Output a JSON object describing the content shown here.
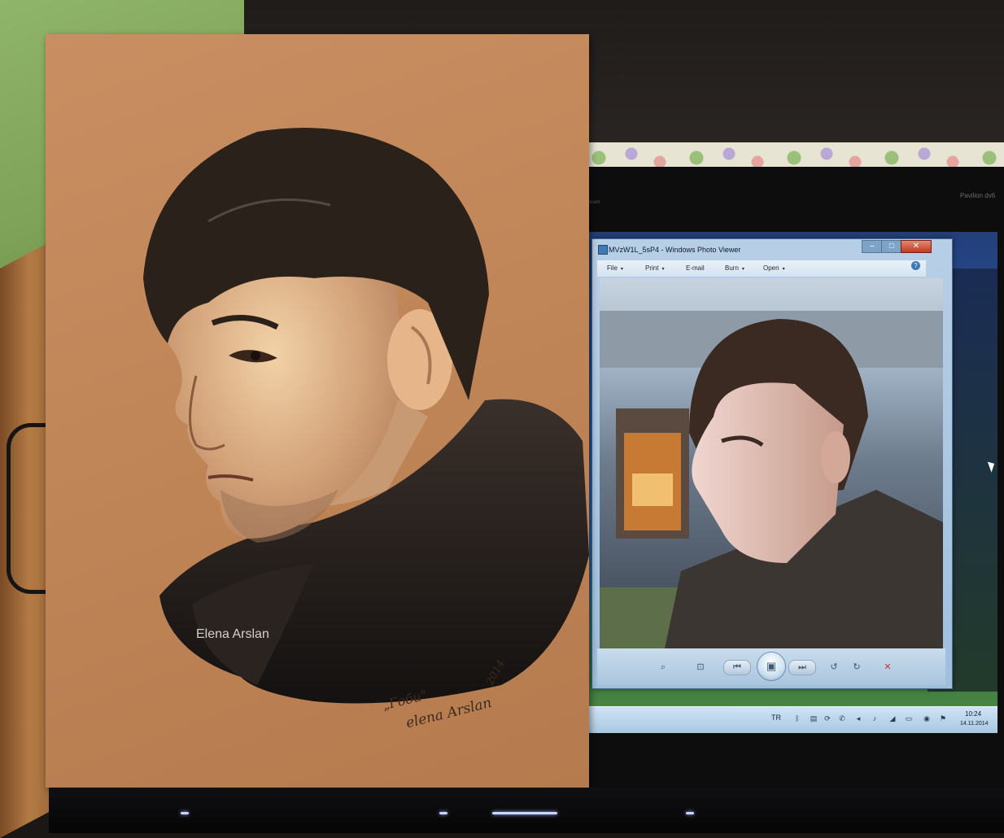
{
  "drawing": {
    "watermark": "Elena Arslan",
    "caption_title": "„Гоби\"",
    "signature": "elena Arslan",
    "year": "2014"
  },
  "laptop": {
    "brand_label": "Pavilion dv6",
    "webcam_label": "Webcam"
  },
  "photo_viewer": {
    "title": "MVzW1L_5sP4 - Windows Photo Viewer",
    "menu": [
      "File",
      "Print",
      "E-mail",
      "Burn",
      "Open"
    ],
    "help_glyph": "?",
    "window_buttons": {
      "minimize": "–",
      "maximize": "□",
      "close": "✕"
    },
    "controls": [
      {
        "name": "zoom-icon",
        "glyph": "⌕"
      },
      {
        "name": "actual-size-icon",
        "glyph": "⊡"
      },
      {
        "name": "previous-icon",
        "glyph": "⏮"
      },
      {
        "name": "slideshow-icon",
        "glyph": "▣"
      },
      {
        "name": "next-icon",
        "glyph": "⏭"
      },
      {
        "name": "rotate-ccw-icon",
        "glyph": "↺"
      },
      {
        "name": "rotate-cw-icon",
        "glyph": "↻"
      },
      {
        "name": "delete-icon",
        "glyph": "✕"
      }
    ]
  },
  "taskbar": {
    "language": "TR",
    "clock_time": "10:24",
    "clock_date": "14.11.2014"
  },
  "colors": {
    "paper": "#c08656",
    "hair": "#2b211b",
    "skin": "#d9b08a",
    "coat": "#1e1a18"
  }
}
